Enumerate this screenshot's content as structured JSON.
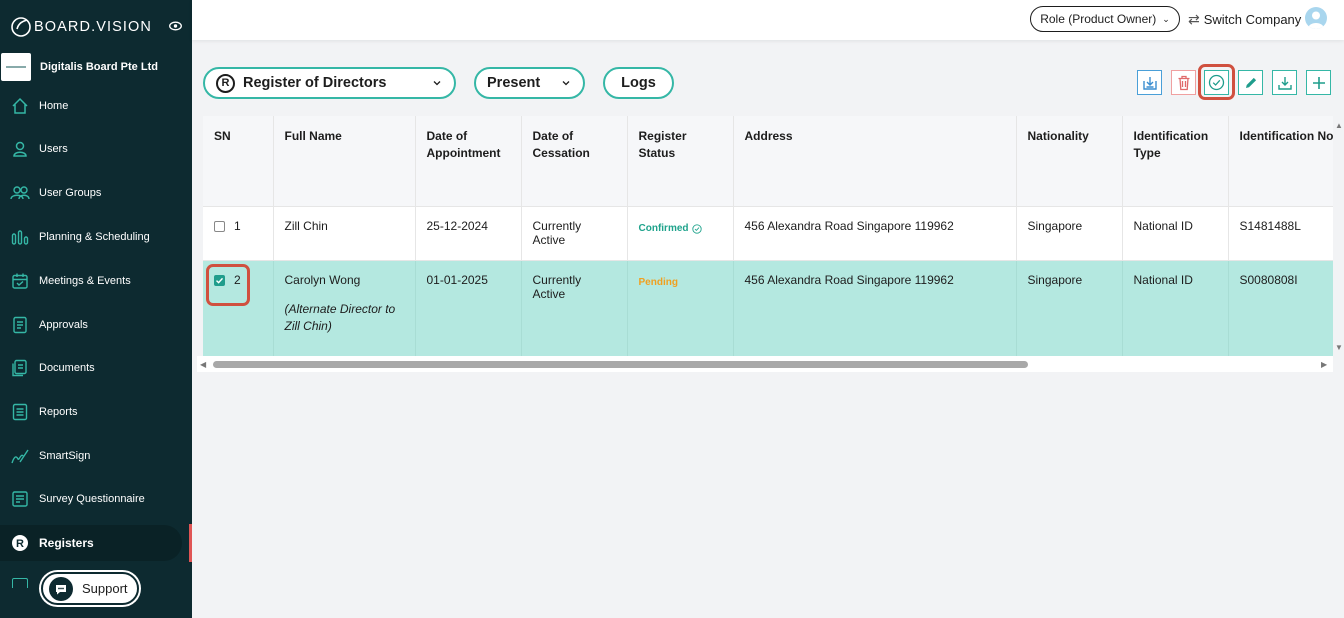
{
  "app": {
    "brand": "BOARD.VISION",
    "company": "Digitalis Board Pte Ltd"
  },
  "topbar": {
    "role": "Role (Product Owner)",
    "switch_company": "Switch Company"
  },
  "sidebar": {
    "items": [
      {
        "label": "Home",
        "icon": "home-icon"
      },
      {
        "label": "Users",
        "icon": "user-icon"
      },
      {
        "label": "User Groups",
        "icon": "user-groups-icon"
      },
      {
        "label": "Planning & Scheduling",
        "icon": "bar-chart-icon"
      },
      {
        "label": "Meetings & Events",
        "icon": "calendar-icon"
      },
      {
        "label": "Approvals",
        "icon": "approvals-icon"
      },
      {
        "label": "Documents",
        "icon": "documents-icon"
      },
      {
        "label": "Reports",
        "icon": "reports-icon"
      },
      {
        "label": "SmartSign",
        "icon": "signature-icon"
      },
      {
        "label": "Survey Questionnaire",
        "icon": "survey-icon"
      },
      {
        "label": "Registers",
        "icon": "registers-icon",
        "active": true
      }
    ],
    "support": "Support"
  },
  "filters": {
    "register": {
      "badge": "R",
      "label": "Register of Directors"
    },
    "period": "Present",
    "logs": "Logs"
  },
  "toolbar": {
    "buttons": [
      "import-icon",
      "trash-icon",
      "check-circle-icon",
      "pencil-icon",
      "download-icon",
      "plus-icon"
    ]
  },
  "table": {
    "columns": [
      "SN",
      "Full Name",
      "Date of Appointment",
      "Date of Cessation",
      "Register Status",
      "Address",
      "Nationality",
      "Identification Type",
      "Identification No."
    ],
    "rows": [
      {
        "sn": "1",
        "checked": false,
        "full_name": "Zill Chin",
        "note": "",
        "date_of_appointment": "25-12-2024",
        "date_of_cessation": "Currently Active",
        "status": "Confirmed",
        "address": "456 Alexandra Road Singapore 119962",
        "nationality": "Singapore",
        "id_type": "National ID",
        "id_no": "S1481488L"
      },
      {
        "sn": "2",
        "checked": true,
        "full_name": "Carolyn Wong",
        "note": "(Alternate Director to Zill Chin)",
        "date_of_appointment": "01-01-2025",
        "date_of_cessation": "Currently Active",
        "status": "Pending",
        "address": "456 Alexandra Road Singapore 119962",
        "nationality": "Singapore",
        "id_type": "National ID",
        "id_no": "S0080808I"
      }
    ]
  },
  "colors": {
    "sidebar_bg": "#0d2a30",
    "accent": "#35b7a6",
    "selected_row": "#b4e8e0",
    "confirmed": "#1fa38c",
    "pending": "#f0a020",
    "highlight": "#d0503f"
  }
}
